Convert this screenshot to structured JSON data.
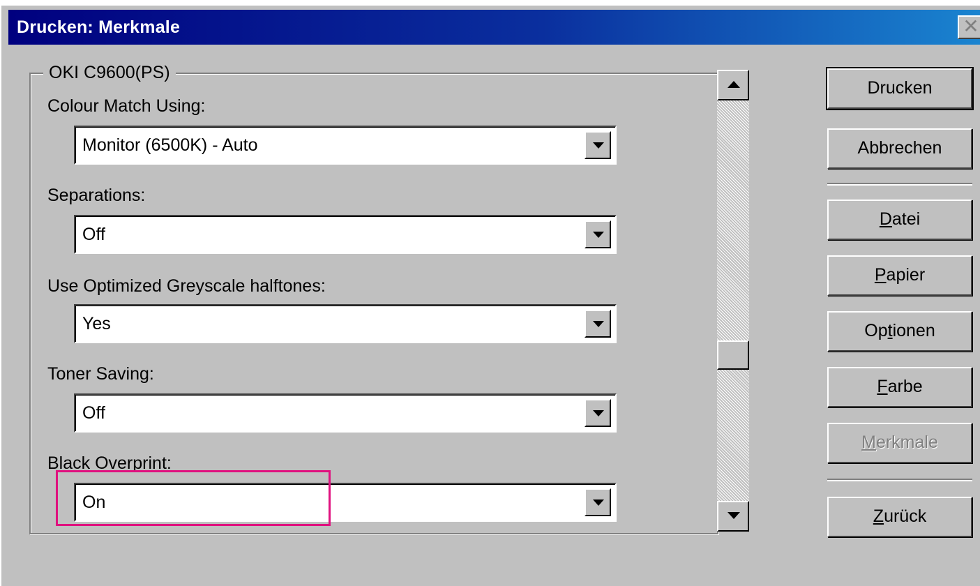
{
  "window": {
    "title": "Drucken: Merkmale"
  },
  "group": {
    "title": "OKI C9600(PS)"
  },
  "fields": [
    {
      "label": "Colour Match Using:",
      "value": "Monitor (6500K) - Auto"
    },
    {
      "label": "Separations:",
      "value": "Off"
    },
    {
      "label": "Use Optimized Greyscale halftones:",
      "value": "Yes"
    },
    {
      "label": "Toner Saving:",
      "value": "Off"
    },
    {
      "label": "Black Overprint:",
      "value": "On"
    }
  ],
  "buttons": {
    "drucken": "Drucken",
    "abbrechen": "Abbrechen",
    "datei": {
      "accel": "D",
      "rest": "atei"
    },
    "papier": {
      "accel": "P",
      "rest": "apier"
    },
    "optionen": {
      "pre": "Op",
      "accel": "t",
      "rest": "ionen"
    },
    "farbe": {
      "accel": "F",
      "rest": "arbe"
    },
    "merkmale": {
      "accel": "M",
      "rest": "erkmale"
    },
    "zurueck": {
      "accel": "Z",
      "rest": "urück"
    }
  },
  "colors": {
    "highlight": "#e0117f",
    "titlebar_start": "#00007f",
    "titlebar_end": "#1a84d0"
  },
  "icons": {
    "close": "close-icon",
    "dropdown": "chevron-down-icon",
    "scroll_up": "arrow-up-icon",
    "scroll_down": "arrow-down-icon"
  }
}
